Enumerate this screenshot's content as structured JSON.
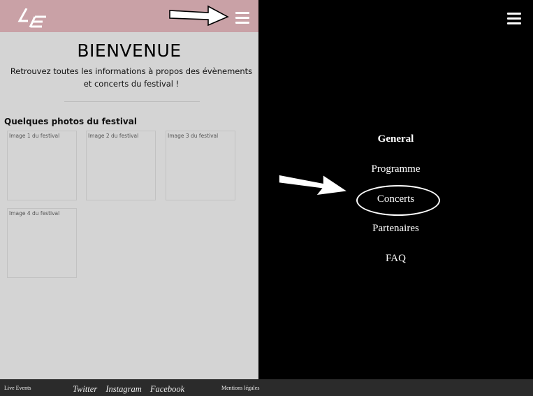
{
  "header": {
    "logo_icon": "le-logo-icon",
    "menu_icon": "hamburger-icon",
    "header_color": "#c9a1a6"
  },
  "main": {
    "title": "BIENVENUE",
    "subtitle": "Retrouvez toutes les informations à propos des évènements et concerts du festival !",
    "gallery_title": "Quelques photos du festival",
    "photos": [
      {
        "alt": "Image 1 du festival"
      },
      {
        "alt": "Image 2 du festival"
      },
      {
        "alt": "Image 3 du festival"
      },
      {
        "alt": "Image 4 du festival"
      }
    ]
  },
  "footer": {
    "brand": "Live Events",
    "socials": [
      "Twitter",
      "Instagram",
      "Facebook"
    ],
    "legal": "Mentions légales"
  },
  "nav_menu": {
    "items": [
      "General",
      "Programme",
      "Concerts",
      "Partenaires",
      "FAQ"
    ],
    "highlighted": "Concerts"
  }
}
